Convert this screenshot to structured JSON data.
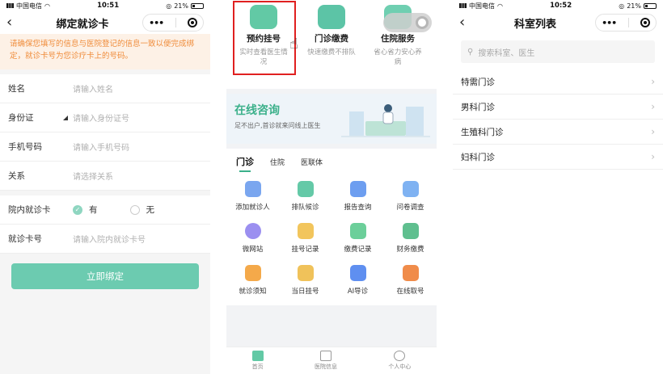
{
  "status_bar": {
    "carrier": "中国电信",
    "battery": "21%"
  },
  "panel1": {
    "time": "10:51",
    "title": "绑定就诊卡",
    "notice": "请确保您填写的信息与医院登记的信息一致以便完成绑定，就诊卡号为您诊疗卡上的号码。",
    "fields": [
      {
        "label": "姓名",
        "placeholder": "请输入姓名"
      },
      {
        "label": "身份证",
        "placeholder": "请输入身份证号"
      },
      {
        "label": "手机号码",
        "placeholder": "请输入手机号码"
      },
      {
        "label": "关系",
        "placeholder": "请选择关系"
      }
    ],
    "card_label": "院内就诊卡",
    "radio_yes": "有",
    "radio_no": "无",
    "card_no_label": "就诊卡号",
    "card_no_placeholder": "请输入院内就诊卡号",
    "submit": "立即绑定"
  },
  "panel2": {
    "services": [
      {
        "name": "预约挂号",
        "desc": "实时查看医生情况"
      },
      {
        "name": "门诊缴费",
        "desc": "快速缴费不排队"
      },
      {
        "name": "住院服务",
        "desc": "省心省力安心养病"
      }
    ],
    "banner_title": "在线咨询",
    "banner_sub": "足不出户,首诊就来问线上医生",
    "tabs": [
      "门诊",
      "住院",
      "医联体"
    ],
    "grid": [
      "添加就诊人",
      "排队候诊",
      "报告查询",
      "问卷调查",
      "微网站",
      "挂号记录",
      "缴费记录",
      "财务缴费",
      "就诊须知",
      "当日挂号",
      "AI导诊",
      "在线取号"
    ],
    "bottom_nav": [
      "首页",
      "医院信息",
      "个人中心"
    ]
  },
  "panel3": {
    "time": "10:52",
    "title": "科室列表",
    "search_placeholder": "搜索科室、医生",
    "departments": [
      "特需门诊",
      "男科门诊",
      "生殖科门诊",
      "妇科门诊"
    ]
  }
}
